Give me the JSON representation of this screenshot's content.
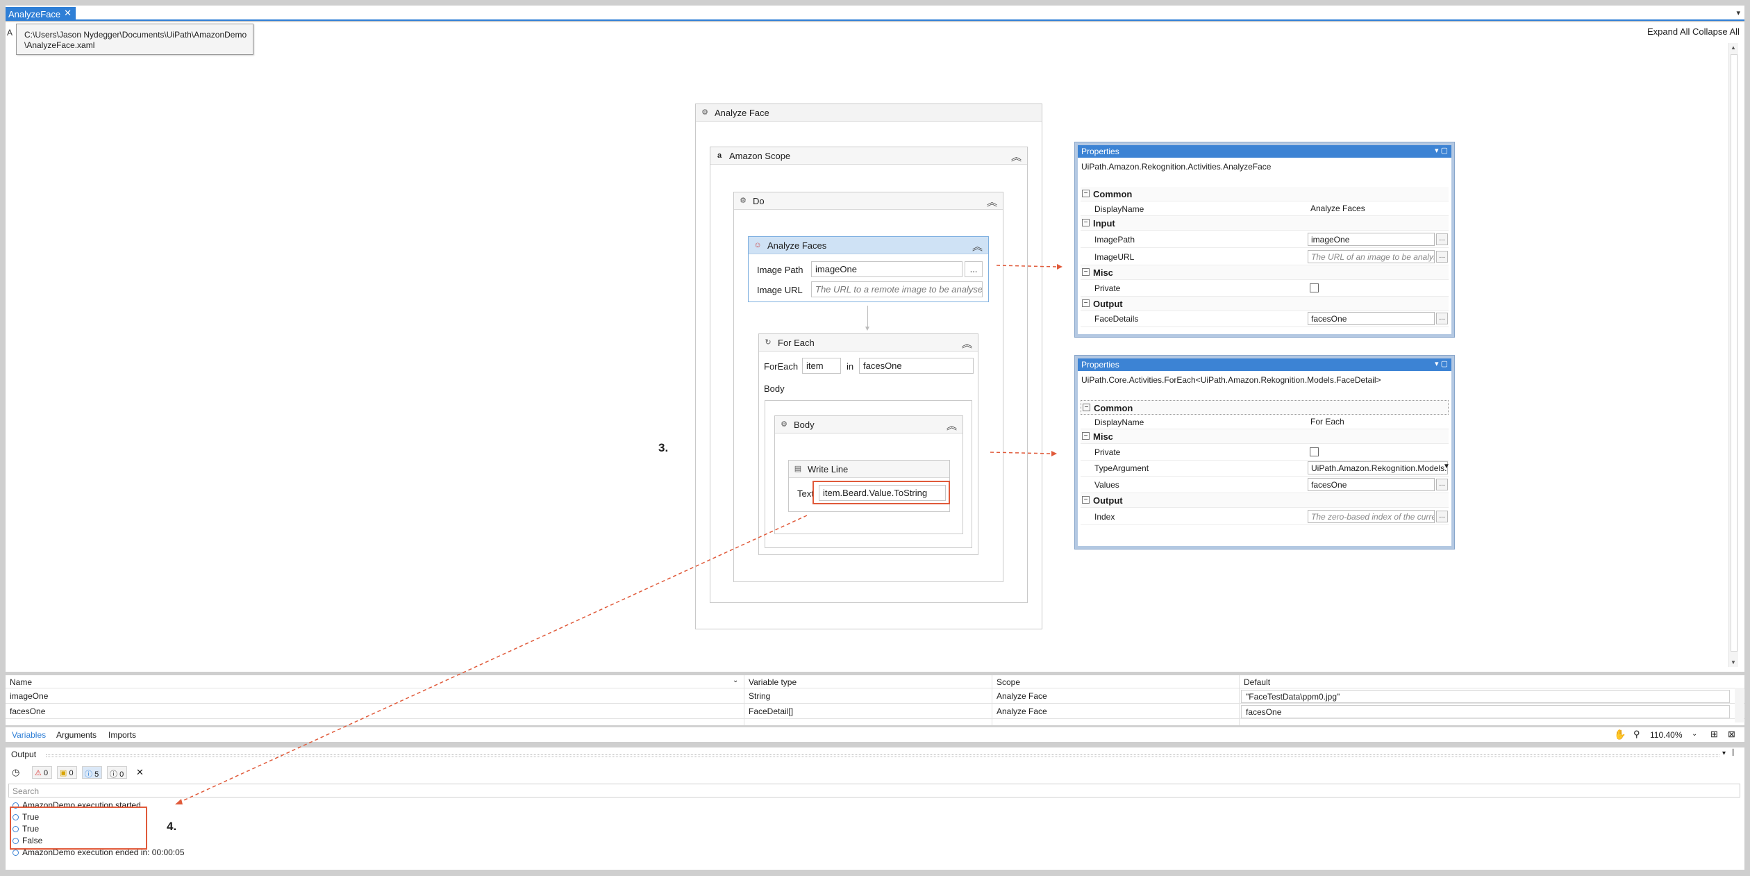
{
  "tabs": {
    "active": "AnalyzeFace",
    "close": "✕",
    "dropdown": "▾"
  },
  "tooltip": {
    "line1": "C:\\Users\\Jason Nydegger\\Documents\\UiPath\\AmazonDemo",
    "line2": "\\AnalyzeFace.xaml"
  },
  "breadcrumb": "A",
  "toolbar": {
    "expand_all": "Expand All",
    "collapse_all": "Collapse All"
  },
  "workflow": {
    "root_title": "Analyze Face",
    "scope_title": "Amazon Scope",
    "do_title": "Do",
    "analyze": {
      "title": "Analyze Faces",
      "image_path_label": "Image Path",
      "image_path_value": "imageOne",
      "image_url_label": "Image URL",
      "image_url_placeholder": "The URL to a remote image to be analysed",
      "dots": "..."
    },
    "foreach": {
      "title": "For Each",
      "foreach_label": "ForEach",
      "item_value": "item",
      "in_label": "in",
      "collection_value": "facesOne",
      "body_label": "Body"
    },
    "body_title": "Body",
    "writeline": {
      "title": "Write Line",
      "text_label": "Text",
      "text_value": "item.Beard.Value.ToString"
    }
  },
  "annotations": {
    "step3": "3.",
    "step4": "4."
  },
  "properties_analyze": {
    "title": "Properties",
    "class": "UiPath.Amazon.Rekognition.Activities.AnalyzeFace",
    "cat_common": "Common",
    "display_name_label": "DisplayName",
    "display_name_value": "Analyze Faces",
    "cat_input": "Input",
    "image_path_label": "ImagePath",
    "image_path_value": "imageOne",
    "image_url_label": "ImageURL",
    "image_url_placeholder": "The URL of an image to be analysed",
    "cat_misc": "Misc",
    "private_label": "Private",
    "cat_output": "Output",
    "face_details_label": "FaceDetails",
    "face_details_value": "facesOne",
    "dots": "..."
  },
  "properties_foreach": {
    "title": "Properties",
    "class": "UiPath.Core.Activities.ForEach<UiPath.Amazon.Rekognition.Models.FaceDetail>",
    "cat_common": "Common",
    "display_name_label": "DisplayName",
    "display_name_value": "For Each",
    "cat_misc": "Misc",
    "private_label": "Private",
    "type_argument_label": "TypeArgument",
    "type_argument_value": "UiPath.Amazon.Rekognition.Models.FaceDetail",
    "values_label": "Values",
    "values_value": "facesOne",
    "cat_output": "Output",
    "index_label": "Index",
    "index_placeholder": "The zero-based index of the current element",
    "dots": "..."
  },
  "variables": {
    "headers": [
      "Name",
      "Variable type",
      "Scope",
      "Default"
    ],
    "rows": [
      {
        "name": "imageOne",
        "type": "String",
        "scope": "Analyze Face",
        "default": "\"FaceTestData\\ppm0.jpg\""
      },
      {
        "name": "facesOne",
        "type": "FaceDetail[]",
        "scope": "Analyze Face",
        "default": "facesOne"
      }
    ],
    "tabs": [
      "Variables",
      "Arguments",
      "Imports"
    ],
    "zoom": "110.40%"
  },
  "output": {
    "title": "Output",
    "errors": "0",
    "warnings": "0",
    "info": "5",
    "trace": "0",
    "search_placeholder": "Search",
    "lines": [
      "AmazonDemo execution started",
      "True",
      "True",
      "False",
      "AmazonDemo execution ended in: 00:00:05"
    ]
  },
  "colors": {
    "accent": "#2f7fd6",
    "annotation": "#e05a3a",
    "selected_activity": "#cfe2f5"
  }
}
